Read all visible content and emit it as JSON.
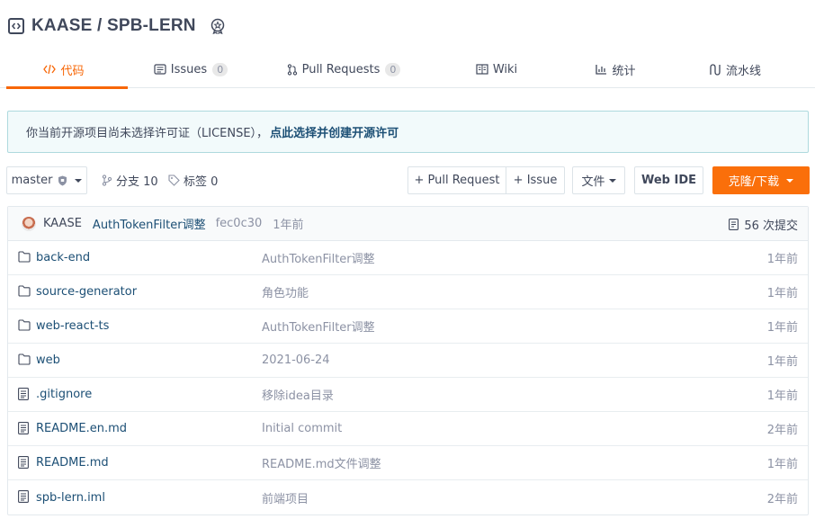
{
  "repo": {
    "title": "KAASE / SPB-LERN"
  },
  "tabs": [
    {
      "label": "代码",
      "icon": "code-icon",
      "active": true
    },
    {
      "label": "Issues",
      "icon": "issues-icon",
      "count": "0"
    },
    {
      "label": "Pull Requests",
      "icon": "pull-request-icon",
      "count": "0"
    },
    {
      "label": "Wiki",
      "icon": "wiki-icon"
    },
    {
      "label": "统计",
      "icon": "stats-icon"
    },
    {
      "label": "流水线",
      "icon": "pipeline-icon"
    }
  ],
  "notice": {
    "text": "你当前开源项目尚未选择许可证（LICENSE），",
    "link": "点此选择并创建开源许可"
  },
  "toolbar": {
    "branch": "master",
    "branches": "分支 10",
    "tags": "标签 0",
    "pull_request": "+ Pull Request",
    "issue": "+ Issue",
    "file": "文件",
    "web_ide": "Web IDE",
    "clone": "克隆/下载"
  },
  "commit": {
    "author": "KAASE",
    "message": "AuthTokenFilter调整",
    "hash": "fec0c30",
    "time": "1年前",
    "count": "56 次提交"
  },
  "files": [
    {
      "name": "back-end",
      "type": "folder",
      "message": "AuthTokenFilter调整",
      "time": "1年前"
    },
    {
      "name": "source-generator",
      "type": "folder",
      "message": "角色功能",
      "time": "1年前"
    },
    {
      "name": "web-react-ts",
      "type": "folder",
      "message": "AuthTokenFilter调整",
      "time": "1年前"
    },
    {
      "name": "web",
      "type": "folder",
      "message": "2021-06-24",
      "time": "1年前"
    },
    {
      "name": ".gitignore",
      "type": "file",
      "message": "移除idea目录",
      "time": "1年前"
    },
    {
      "name": "README.en.md",
      "type": "file",
      "message": "Initial commit",
      "time": "2年前"
    },
    {
      "name": "README.md",
      "type": "file",
      "message": "README.md文件调整",
      "time": "1年前"
    },
    {
      "name": "spb-lern.iml",
      "type": "file",
      "message": "前端项目",
      "time": "2年前"
    }
  ],
  "colors": {
    "accent": "#f76707",
    "link": "#1c4f75",
    "muted": "#8c92a4"
  }
}
